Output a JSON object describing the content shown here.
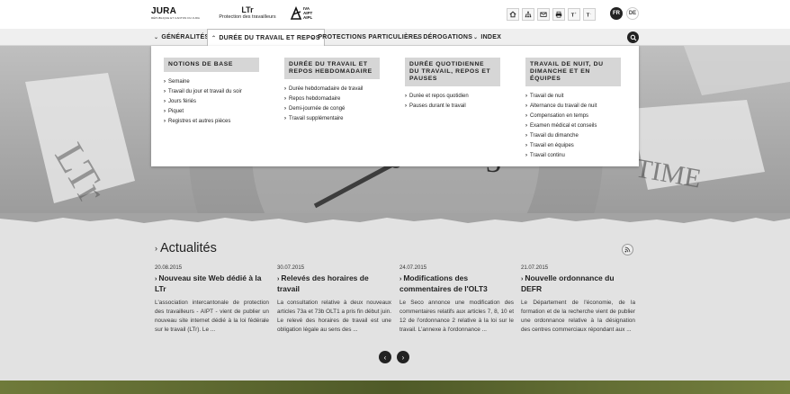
{
  "header": {
    "jura_logo": "JURA",
    "jura_sub": "RÉPUBLIQUE ET CANTON DU JURA",
    "ltr_title": "LTr",
    "ltr_sub": "Protection des travailleurs",
    "iva_lines": [
      "IVA",
      "AIPT",
      "AIPL"
    ],
    "utility_icons": [
      "home-icon",
      "sitemap-icon",
      "mail-icon",
      "print-icon",
      "text-larger-icon",
      "text-smaller-icon"
    ],
    "languages": {
      "active": "FR",
      "other": "DE"
    }
  },
  "nav": {
    "items": [
      {
        "label": "Généralités"
      },
      {
        "label": "Durée du travail et repos"
      },
      {
        "label": "Protections particulières"
      },
      {
        "label": "Dérogations"
      },
      {
        "label": "Index"
      }
    ]
  },
  "mega_menu": {
    "columns": [
      {
        "heading": "Notions de base",
        "links": [
          "Semaine",
          "Travail du jour et travail du soir",
          "Jours fériés",
          "Piquet",
          "Registres et autres pièces"
        ]
      },
      {
        "heading": "Durée du travail et repos hebdomadaire",
        "links": [
          "Durée hebdomadaire de travail",
          "Repos hebdomadaire",
          "Demi-journée de congé",
          "Travail supplémentaire"
        ]
      },
      {
        "heading": "Durée quotidienne du travail, repos et pauses",
        "links": [
          "Durée et repos quotidien",
          "Pauses durant le travail"
        ]
      },
      {
        "heading": "Travail de nuit, du dimanche et en équipes",
        "links": [
          "Travail de nuit",
          "Alternance du travail de nuit",
          "Compensation en temps",
          "Examen médical et conseils",
          "Travail du dimanche",
          "Travail en équipes",
          "Travail continu"
        ]
      }
    ]
  },
  "news": {
    "title": "Actualités",
    "articles": [
      {
        "date": "20.08.2015",
        "title": "Nouveau site Web dédié à la LTr",
        "text": "L'association intercantonale de protection des travailleurs - AIPT - vient de publier un nouveau site internet dédié à la loi fédérale sur le travail (LTr). Le ..."
      },
      {
        "date": "30.07.2015",
        "title": "Relevés des horaires de travail",
        "text": "La consultation relative à deux nouveaux articles 73a et 73b OLT1 a pris fin début juin. Le relevé des horaires de travail est une obligation légale au sens des ..."
      },
      {
        "date": "24.07.2015",
        "title": "Modifications des commentaires de l'OLT3",
        "text": "Le Seco annonce une modification des commentaires relatifs aux articles 7, 8, 10 et 12 de l'ordonnance 2 relative à la loi sur le travail. L'annexe à l'ordonnance ..."
      },
      {
        "date": "21.07.2015",
        "title": "Nouvelle ordonnance du DEFR",
        "text": "Le Département de l'économie, de la formation et de la recherche vient de publier une ordonnance relative à la désignation des centres commerciaux répondant aux ..."
      }
    ]
  }
}
